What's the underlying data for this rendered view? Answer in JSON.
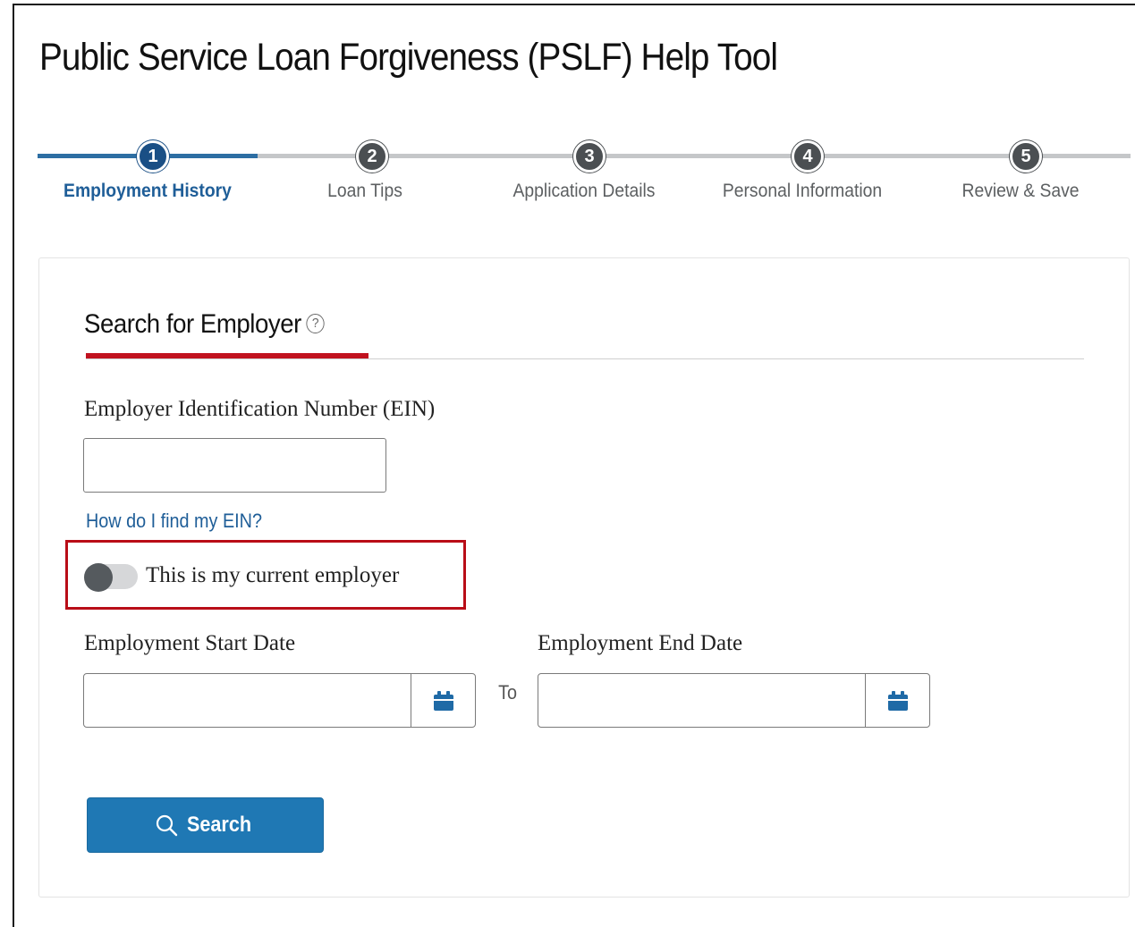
{
  "page": {
    "title": "Public Service Loan Forgiveness (PSLF) Help Tool"
  },
  "stepper": {
    "active_color": "#1f5e98",
    "steps": [
      {
        "number": "1",
        "label": "Employment History",
        "active": true
      },
      {
        "number": "2",
        "label": "Loan Tips",
        "active": false
      },
      {
        "number": "3",
        "label": "Application Details",
        "active": false
      },
      {
        "number": "4",
        "label": "Personal Information",
        "active": false
      },
      {
        "number": "5",
        "label": "Review & Save",
        "active": false
      }
    ]
  },
  "search_section": {
    "heading": "Search for Employer",
    "help_icon": "question-circle-icon",
    "accent_color": "#c1121f",
    "ein_label": "Employer Identification Number (EIN)",
    "ein_value": "",
    "ein_link": "How do I find my EIN?",
    "current_employer_toggle": {
      "label": "This is my current employer",
      "checked": false
    },
    "start_date_label": "Employment Start Date",
    "start_date_value": "",
    "to_label": "To",
    "end_date_label": "Employment End Date",
    "end_date_value": "",
    "calendar_icon": "calendar-icon",
    "search_button": "Search",
    "search_icon": "search-icon",
    "button_color": "#1f78b4"
  }
}
